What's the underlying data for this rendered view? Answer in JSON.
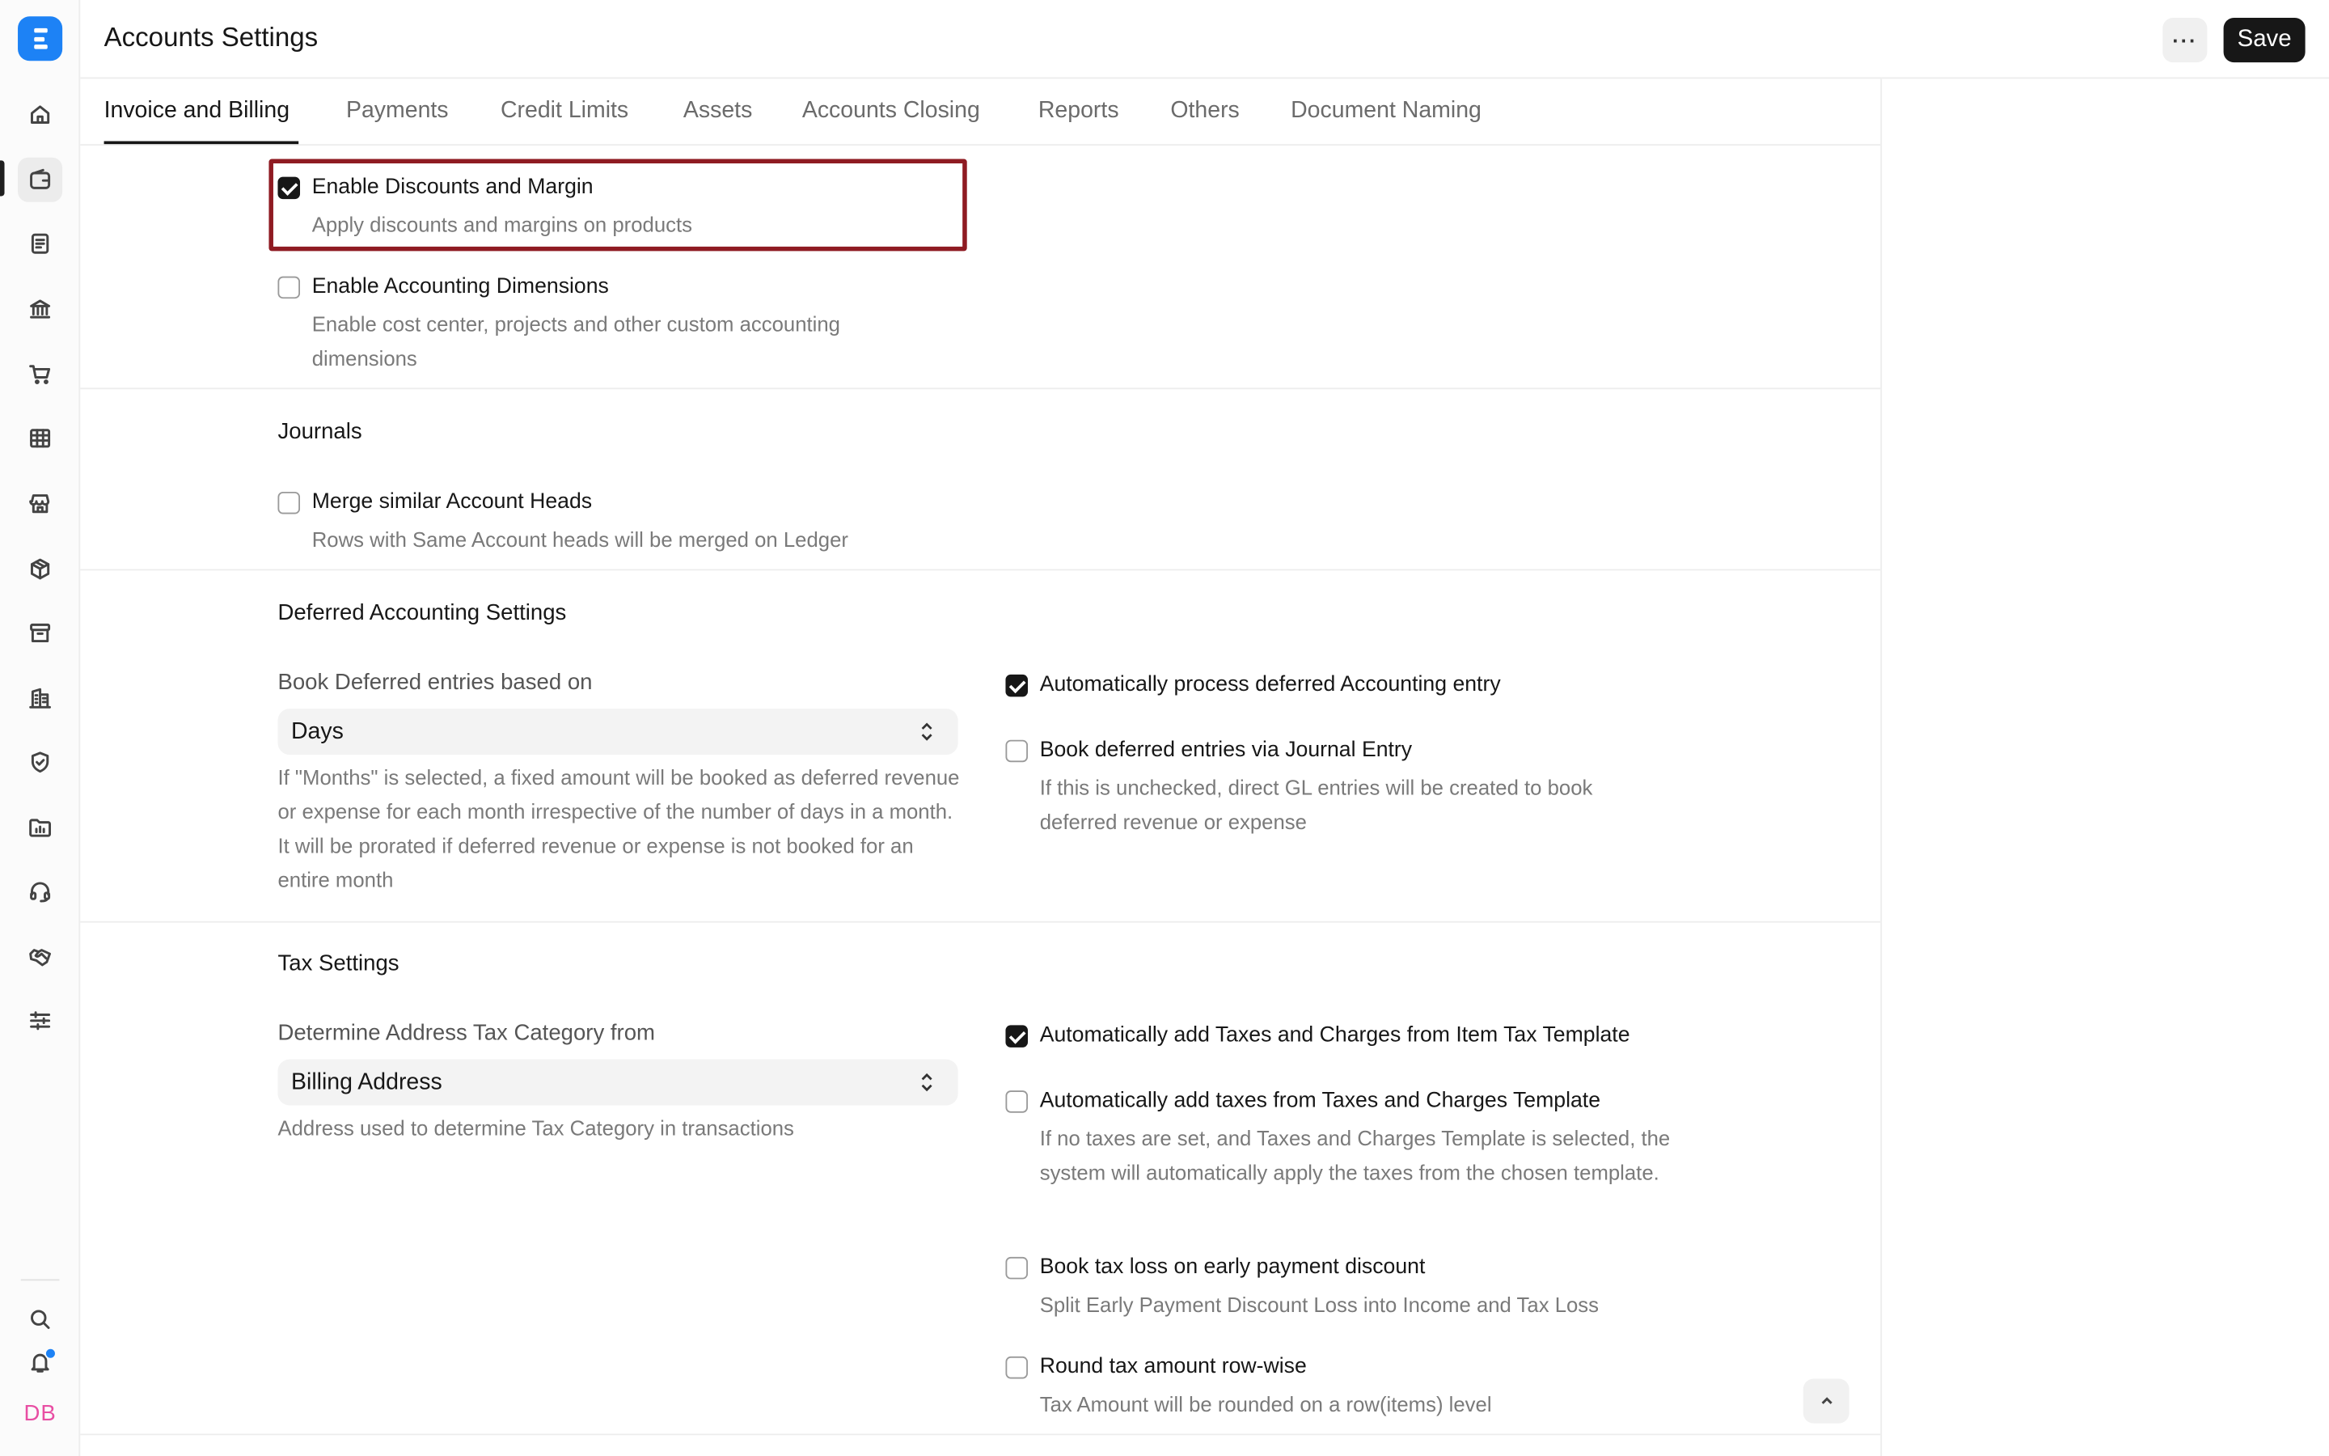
{
  "app": {
    "avatar_initials": "DB",
    "accent_color": "#1d82f5"
  },
  "sidebar": {
    "items": [
      {
        "name": "home-icon"
      },
      {
        "name": "wallet-icon",
        "active": true
      },
      {
        "name": "invoice-icon"
      },
      {
        "name": "bank-icon"
      },
      {
        "name": "shopping-cart-icon"
      },
      {
        "name": "table-icon"
      },
      {
        "name": "store-icon"
      },
      {
        "name": "box-icon"
      },
      {
        "name": "archive-icon"
      },
      {
        "name": "building-icon"
      },
      {
        "name": "shield-icon"
      },
      {
        "name": "folder-chart-icon"
      },
      {
        "name": "headset-icon"
      },
      {
        "name": "handshake-icon"
      },
      {
        "name": "sliders-icon"
      }
    ],
    "bottom": [
      {
        "name": "search-icon"
      },
      {
        "name": "bell-icon"
      }
    ]
  },
  "header": {
    "title": "Accounts Settings",
    "more_label": "···",
    "save_label": "Save"
  },
  "tabs": [
    {
      "label": "Invoice and Billing",
      "active": true
    },
    {
      "label": "Payments"
    },
    {
      "label": "Credit Limits"
    },
    {
      "label": "Assets"
    },
    {
      "label": "Accounts Closing"
    },
    {
      "label": "Reports"
    },
    {
      "label": "Others"
    },
    {
      "label": "Document Naming"
    }
  ],
  "invoice": {
    "discounts": {
      "label": "Enable Discounts and Margin",
      "desc": "Apply discounts and margins on products",
      "checked": true
    },
    "dimensions": {
      "label": "Enable Accounting Dimensions",
      "desc": "Enable cost center, projects and other custom accounting dimensions",
      "checked": false
    }
  },
  "journals": {
    "title": "Journals",
    "merge": {
      "label": "Merge similar Account Heads",
      "desc": "Rows with Same Account heads will be merged on Ledger",
      "checked": false
    }
  },
  "deferred": {
    "title": "Deferred Accounting Settings",
    "book_based_on": {
      "label": "Book Deferred entries based on",
      "value": "Days",
      "desc": "If \"Months\" is selected, a fixed amount will be booked as deferred revenue or expense for each month irrespective of the number of days in a month. It will be prorated if deferred revenue or expense is not booked for an entire month"
    },
    "auto_process": {
      "label": "Automatically process deferred Accounting entry",
      "checked": true
    },
    "via_journal": {
      "label": "Book deferred entries via Journal Entry",
      "desc": "If this is unchecked, direct GL entries will be created to book deferred revenue or expense",
      "checked": false
    }
  },
  "tax": {
    "title": "Tax Settings",
    "address_category": {
      "label": "Determine Address Tax Category from",
      "value": "Billing Address",
      "desc": "Address used to determine Tax Category in transactions"
    },
    "auto_item_tax": {
      "label": "Automatically add Taxes and Charges from Item Tax Template",
      "checked": true
    },
    "auto_template_tax": {
      "label": "Automatically add taxes from Taxes and Charges Template",
      "desc": "If no taxes are set, and Taxes and Charges Template is selected, the system will automatically apply the taxes from the chosen template.",
      "checked": false
    },
    "tax_loss": {
      "label": "Book tax loss on early payment discount",
      "desc": "Split Early Payment Discount Loss into Income and Tax Loss",
      "checked": false
    },
    "round_row": {
      "label": "Round tax amount row-wise",
      "desc": "Tax Amount will be rounded on a row(items) level",
      "checked": false
    }
  }
}
